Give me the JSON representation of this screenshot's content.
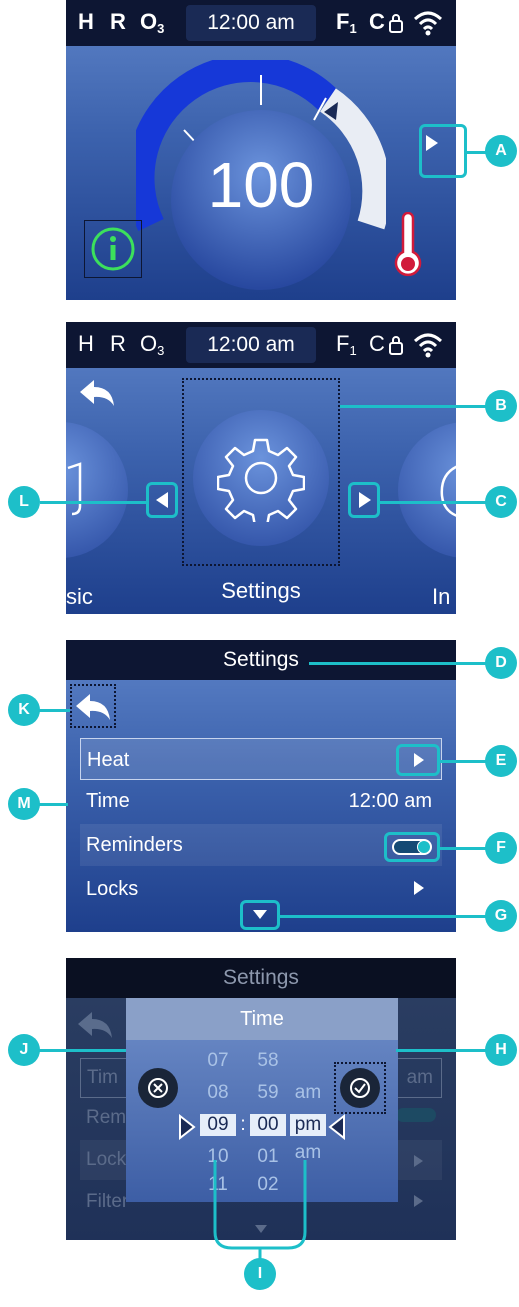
{
  "status_bar": {
    "h": "H",
    "r": "R",
    "o": "O",
    "o_sub": "3",
    "time": "12:00 am",
    "f": "F",
    "f_sub": "1",
    "c": "C"
  },
  "screen1": {
    "temperature": "100"
  },
  "screen2": {
    "left_item": "sic",
    "center_item": "Settings",
    "right_item": "In"
  },
  "screen3": {
    "title": "Settings",
    "rows": [
      {
        "label": "Heat"
      },
      {
        "label": "Time",
        "value": "12:00 am"
      },
      {
        "label": "Reminders"
      },
      {
        "label": "Locks"
      }
    ]
  },
  "screen4": {
    "title": "Settings",
    "dialog_title": "Time",
    "hours": [
      "07",
      "08",
      "09",
      "10",
      "11"
    ],
    "minutes": [
      "58",
      "59",
      "00",
      "01",
      "02"
    ],
    "ampm": [
      "am",
      "pm",
      "am"
    ],
    "separator": ":",
    "bg_rows": [
      "Tim",
      "Rem",
      "Lock",
      "Filter"
    ],
    "bg_time_value": "am"
  },
  "callouts": {
    "a": "A",
    "b": "B",
    "c": "C",
    "d": "D",
    "e": "E",
    "f": "F",
    "g": "G",
    "h": "H",
    "i": "I",
    "j": "J",
    "k": "K",
    "l": "L",
    "m": "M"
  },
  "colors": {
    "accent": "#1dbfc9",
    "dial_blue": "#1638d8",
    "statusbar": "#0d1633"
  }
}
